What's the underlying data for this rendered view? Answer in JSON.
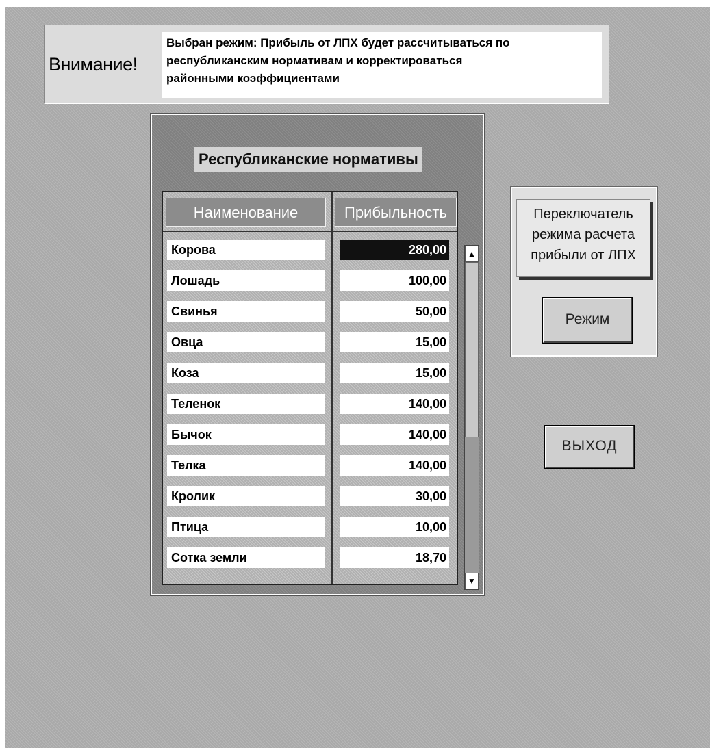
{
  "warning": {
    "title": "Внимание!",
    "message": "Выбран режим: Прибыль от ЛПХ будет рассчитываться по\n  республиканским нормативам и корректироваться\n  районными коэффициентами"
  },
  "norms": {
    "title": "Республиканские нормативы",
    "columns": [
      "Наименование",
      "Прибыльность"
    ],
    "rows": [
      {
        "name": "Корова",
        "value": "280,00"
      },
      {
        "name": "Лошадь",
        "value": "100,00"
      },
      {
        "name": "Свинья",
        "value": "50,00"
      },
      {
        "name": "Овца",
        "value": "15,00"
      },
      {
        "name": "Коза",
        "value": "15,00"
      },
      {
        "name": "Теленок",
        "value": "140,00"
      },
      {
        "name": "Бычок",
        "value": "140,00"
      },
      {
        "name": "Телка",
        "value": "140,00"
      },
      {
        "name": "Кролик",
        "value": "30,00"
      },
      {
        "name": "Птица",
        "value": "10,00"
      },
      {
        "name": "Сотка земли",
        "value": "18,70"
      }
    ],
    "selected_row": 0,
    "scrollbar": {
      "up_icon": "arrow-up-icon",
      "down_icon": "arrow-down-icon"
    }
  },
  "mode_switch": {
    "label": "Переключатель\nрежима расчета\nприбыли от ЛПХ",
    "button": "Режим"
  },
  "exit_button": "ВЫХОД"
}
